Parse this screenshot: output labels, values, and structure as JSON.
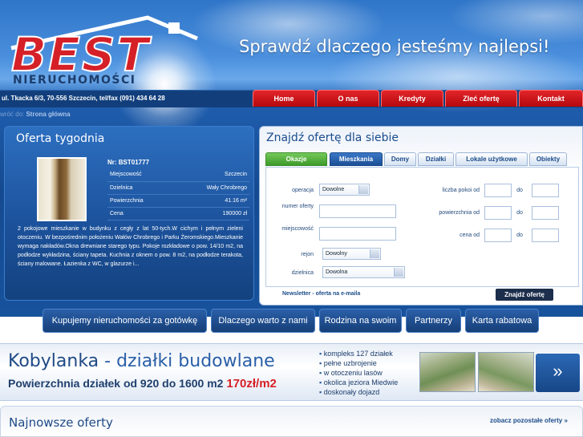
{
  "header": {
    "logo_text": "BEST",
    "logo_subtext": "NIERUCHOMOŚCI",
    "slogan": "Sprawdź dlaczego jesteśmy najlepsi!",
    "address": "ul. Tkacka 6/3,  70-556 Szczecin, tel/fax (091)  434 64 28"
  },
  "nav": {
    "items": [
      "Home",
      "O nas",
      "Kredyty",
      "Zleć ofertę",
      "Kontakt"
    ]
  },
  "breadcrumb": {
    "prefix": "wróć do:",
    "link": "Strona główna"
  },
  "offer_of_week": {
    "title": "Oferta tygodnia",
    "number": "Nr: BST01777",
    "rows": [
      {
        "label": "Miejscowość",
        "value": "Szczecin"
      },
      {
        "label": "Dzielnica",
        "value": "Wały Chrobrego"
      },
      {
        "label": "Powierzchnia",
        "value": "41.16 m²"
      },
      {
        "label": "Cena",
        "value": "190000 zł"
      }
    ],
    "description": "2 pokojowe mieszkanie w budynku z cegły z lat 50-tych.W cichym i pełnym zieleni otoczeniu. W bezpośrednim położeniu Wałów Chrobrego i Parku Żeromskiego.Mieszkanie wymaga nakładów.Okna drewniane starego typu. Pokoje rozkładowe o pow. 14/10 m2, na podłodze wykładzina, ściany tapeta. Kuchnia z oknem o pow. 8 m2, na podłodze terakota, ściany malowane. Łazienka z WC, w glazurze i..."
  },
  "search": {
    "title": "Znajdź ofertę dla siebie",
    "tabs": [
      "Okazje",
      "Mieszkania",
      "Domy",
      "Działki",
      "Lokale użytkowe",
      "Obiekty"
    ],
    "fields": {
      "operacja_label": "operacja",
      "operacja_value": "Dowolne",
      "numer_label": "numer oferty",
      "miejscowosc_label": "miejscowość",
      "rejon_label": "rejon",
      "rejon_value": "Dowolny",
      "dzielnica_label": "dzielnica",
      "dzielnica_value": "Dowolna",
      "pokoi_label": "liczba pokoi od",
      "pow_label": "powierzchnia od",
      "cena_label": "cena od",
      "do_label": "do"
    },
    "newsletter": "Newsletter - oferta na e-maila",
    "submit": "Znajdź ofertę"
  },
  "quick_links": [
    "Kupujemy nieruchomości za gotówkę",
    "Dlaczego warto z nami",
    "Rodzina na swoim",
    "Partnerzy",
    "Karta rabatowa"
  ],
  "banner": {
    "title_place": "Kobylanka",
    "title_rest": "- działki budowlane",
    "subtitle": "Powierzchnia działek od 920 do 1600 m2",
    "price": "170zł/m2",
    "features": [
      "kompleks 127 działek",
      "pełne uzbrojenie",
      "w otoczeniu lasów",
      "okolica jeziora Miedwie",
      "doskonały dojazd"
    ],
    "arrow": "»"
  },
  "newest": {
    "title": "Najnowsze oferty",
    "more": "zobacz pozostałe oferty »"
  },
  "colors": {
    "brand_red": "#d62028",
    "brand_blue": "#1c4c8a",
    "tab_green": "#3d9a2a"
  }
}
